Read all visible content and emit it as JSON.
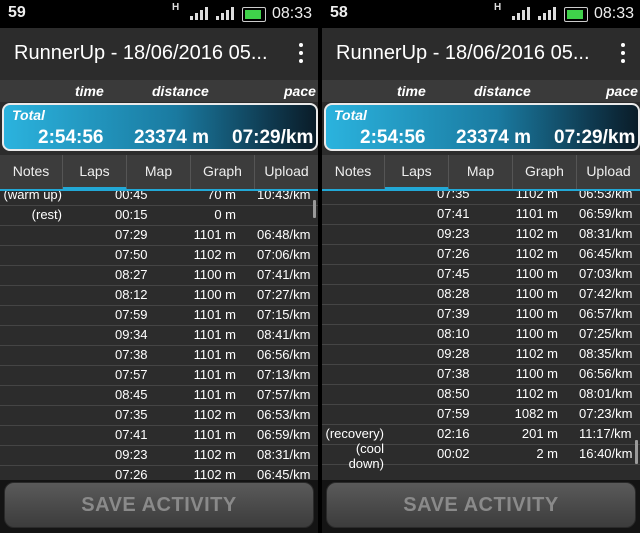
{
  "screens": [
    {
      "status": {
        "notifications": "59",
        "network": "H",
        "time": "08:33"
      },
      "app_title": "RunnerUp - 18/06/2016 05...",
      "summary": {
        "col_time": "time",
        "col_distance": "distance",
        "col_pace": "pace",
        "total_label": "Total",
        "total_time": "2:54:56",
        "total_distance": "23374 m",
        "total_pace": "07:29/km"
      },
      "tabs": [
        "Notes",
        "Laps",
        "Map",
        "Graph",
        "Upload"
      ],
      "active_tab": "Laps",
      "laps": [
        [
          "(warm up)",
          "00:45",
          "70 m",
          "10:43/km"
        ],
        [
          "(rest)",
          "00:15",
          "0 m",
          ""
        ],
        [
          "",
          "07:29",
          "1101 m",
          "06:48/km"
        ],
        [
          "",
          "07:50",
          "1102 m",
          "07:06/km"
        ],
        [
          "",
          "08:27",
          "1100 m",
          "07:41/km"
        ],
        [
          "",
          "08:12",
          "1100 m",
          "07:27/km"
        ],
        [
          "",
          "07:59",
          "1101 m",
          "07:15/km"
        ],
        [
          "",
          "09:34",
          "1101 m",
          "08:41/km"
        ],
        [
          "",
          "07:38",
          "1101 m",
          "06:56/km"
        ],
        [
          "",
          "07:57",
          "1101 m",
          "07:13/km"
        ],
        [
          "",
          "08:45",
          "1101 m",
          "07:57/km"
        ],
        [
          "",
          "07:35",
          "1102 m",
          "06:53/km"
        ],
        [
          "",
          "07:41",
          "1101 m",
          "06:59/km"
        ],
        [
          "",
          "09:23",
          "1102 m",
          "08:31/km"
        ],
        [
          "",
          "07:26",
          "1102 m",
          "06:45/km"
        ]
      ],
      "save_label": "SAVE ACTIVITY"
    },
    {
      "status": {
        "notifications": "58",
        "network": "H",
        "time": "08:33"
      },
      "app_title": "RunnerUp - 18/06/2016 05...",
      "summary": {
        "col_time": "time",
        "col_distance": "distance",
        "col_pace": "pace",
        "total_label": "Total",
        "total_time": "2:54:56",
        "total_distance": "23374 m",
        "total_pace": "07:29/km"
      },
      "tabs": [
        "Notes",
        "Laps",
        "Map",
        "Graph",
        "Upload"
      ],
      "active_tab": "Laps",
      "laps": [
        [
          "",
          "07:35",
          "1102 m",
          "06:53/km"
        ],
        [
          "",
          "07:41",
          "1101 m",
          "06:59/km"
        ],
        [
          "",
          "09:23",
          "1102 m",
          "08:31/km"
        ],
        [
          "",
          "07:26",
          "1102 m",
          "06:45/km"
        ],
        [
          "",
          "07:45",
          "1100 m",
          "07:03/km"
        ],
        [
          "",
          "08:28",
          "1100 m",
          "07:42/km"
        ],
        [
          "",
          "07:39",
          "1100 m",
          "06:57/km"
        ],
        [
          "",
          "08:10",
          "1100 m",
          "07:25/km"
        ],
        [
          "",
          "09:28",
          "1102 m",
          "08:35/km"
        ],
        [
          "",
          "07:38",
          "1100 m",
          "06:56/km"
        ],
        [
          "",
          "08:50",
          "1102 m",
          "08:01/km"
        ],
        [
          "",
          "07:59",
          "1082 m",
          "07:23/km"
        ],
        [
          "(recovery)",
          "02:16",
          "201 m",
          "11:17/km"
        ],
        [
          "(cool down)",
          "00:02",
          "2 m",
          "16:40/km"
        ]
      ],
      "save_label": "SAVE ACTIVITY"
    }
  ],
  "colors": {
    "accent": "#22a8d6",
    "battery": "#3fd14a",
    "background": "#2c2c2c"
  },
  "icons": [
    "signal-icon",
    "battery-icon",
    "overflow-menu-icon"
  ]
}
